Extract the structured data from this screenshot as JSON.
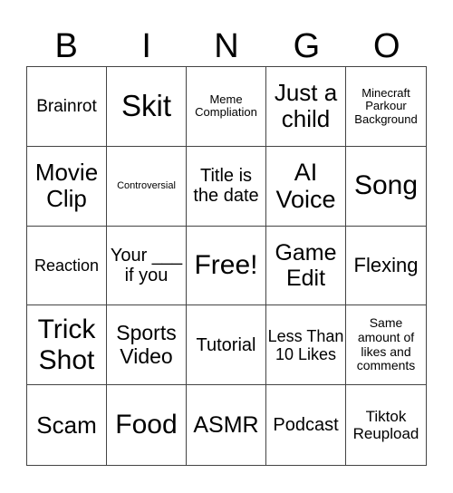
{
  "header": [
    "B",
    "I",
    "N",
    "G",
    "O"
  ],
  "cells": [
    "Brainrot",
    "Skit",
    "Meme Compliation",
    "Just a child",
    "Minecraft Parkour Background",
    "Movie Clip",
    "Controversial",
    "Title is the date",
    "AI Voice",
    "Song",
    "Reaction",
    "Your ___ if you",
    "Free!",
    "Game Edit",
    "Flexing",
    "Trick Shot",
    "Sports Video",
    "Tutorial",
    "Less Than 10 Likes",
    "Same amount of likes and comments",
    "Scam",
    "Food",
    "ASMR",
    "Podcast",
    "Tiktok Reupload"
  ]
}
